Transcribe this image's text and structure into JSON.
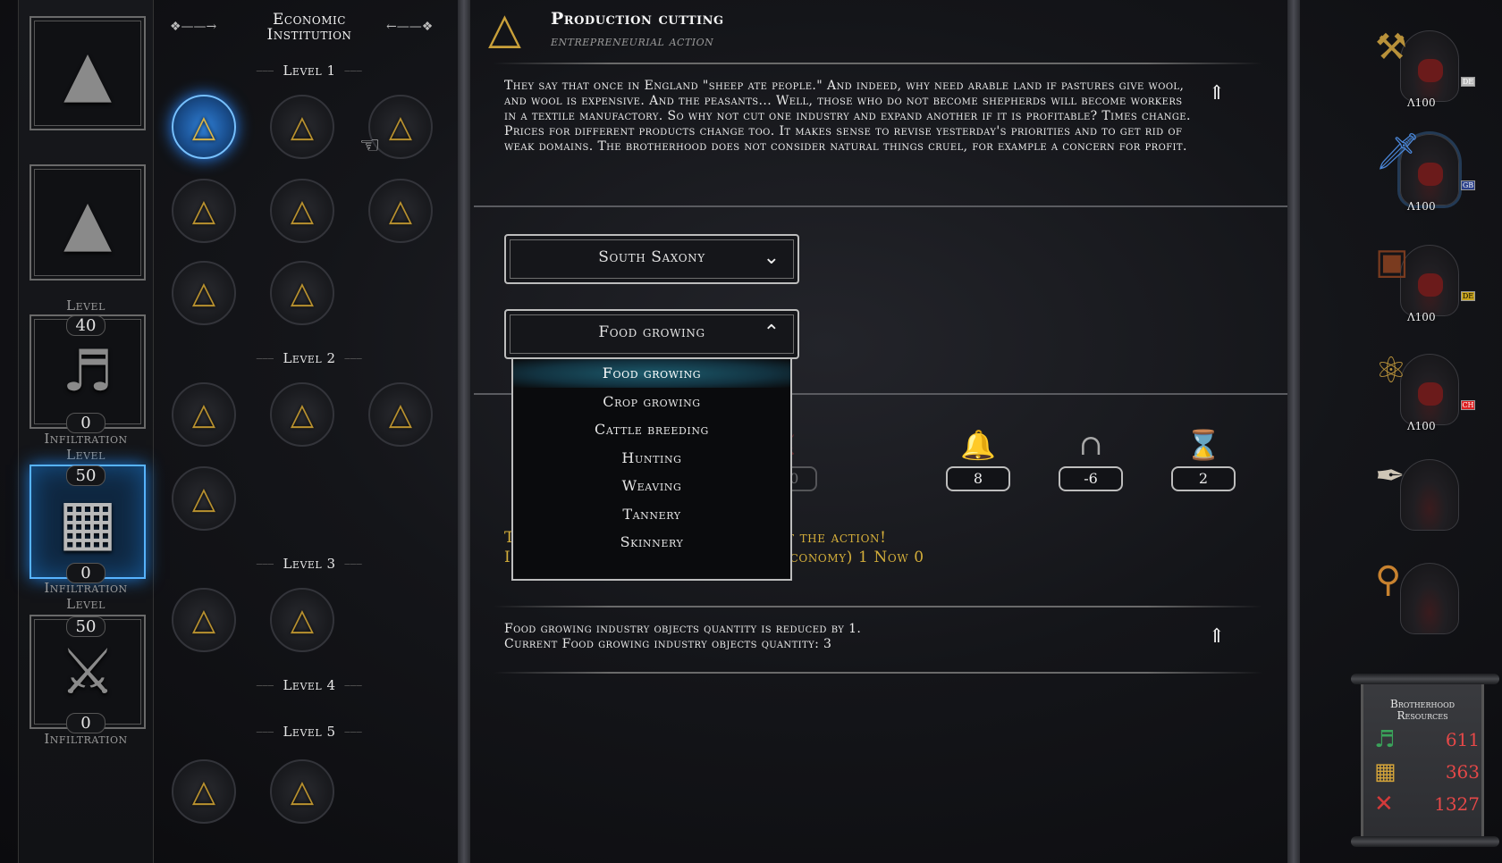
{
  "institutions": [
    {
      "name": "hooded-figure",
      "level_label": "",
      "level": "",
      "value": "",
      "infiltration_label": ""
    },
    {
      "name": "pyramid-eye",
      "level_label": "Level",
      "level": "40",
      "value": "",
      "infiltration_label": ""
    },
    {
      "name": "lyre",
      "level_label": "Level",
      "level": "50",
      "value": "0",
      "infiltration_label": "Infiltration"
    },
    {
      "name": "gold-bars",
      "level_label": "Level",
      "level": "50",
      "value": "0",
      "infiltration_label": "Infiltration"
    },
    {
      "name": "crossed-swords",
      "level_label": "",
      "level": "",
      "value": "0",
      "infiltration_label": "Infiltration"
    }
  ],
  "tree": {
    "title_line1": "Economic",
    "title_line2": "Institution",
    "levels": [
      "Level 1",
      "Level 2",
      "Level 3",
      "Level 4",
      "Level 5"
    ]
  },
  "action": {
    "title": "Production cutting",
    "subtitle": "entrepreneurial action",
    "description": "They say that once in England \"sheep ate people.\" And indeed, why need arable land if pastures give wool, and wool is expensive. And the peasants... Well, those who do not become shepherds will become workers in a textile manufactory. So why not cut one industry and expand another if it is profitable? Times change. Prices for different products change too. It makes sense to revise yesterday's priorities and to get rid of weak domains. The brotherhood does not consider natural things cruel, for example a concern for profit."
  },
  "region_dropdown": {
    "value": "South Saxony"
  },
  "industry_dropdown": {
    "value": "Food growing",
    "options": [
      "Food growing",
      "Crop growing",
      "Cattle breeding",
      "Hunting",
      "Weaving",
      "Tannery",
      "Skinnery"
    ],
    "highlighted": "Food growing"
  },
  "stats": {
    "hidden_1": "100",
    "hidden_2": "100",
    "bell": "8",
    "influence": "-6",
    "time": "2"
  },
  "warning": {
    "line1": "The lodge needs to be active to start the action!",
    "line2": "Infiltration Economic Institution (Economy) 1 Now 0"
  },
  "result": {
    "line1": "Food growing industry objects quantity is reduced by 1.",
    "line2": "Current Food growing industry objects quantity: 3"
  },
  "agents": [
    {
      "tool": "hammer",
      "level": "100",
      "flag": "DE"
    },
    {
      "tool": "sword",
      "level": "100",
      "flag": "GB"
    },
    {
      "tool": "book",
      "level": "100",
      "flag": "DE"
    },
    {
      "tool": "key",
      "level": "100",
      "flag": "CH"
    },
    {
      "tool": "quill",
      "level": "",
      "flag": ""
    },
    {
      "tool": "horn",
      "level": "",
      "flag": ""
    }
  ],
  "resources": {
    "title_line1": "Brotherhood",
    "title_line2": "Resources",
    "items": [
      {
        "icon": "lyre-icon",
        "value": "611",
        "color": "#3aa35a"
      },
      {
        "icon": "gold-icon",
        "value": "363",
        "color": "#d4a43a"
      },
      {
        "icon": "swords-icon",
        "value": "1327",
        "color": "#d33a3a"
      }
    ]
  },
  "colors": {
    "accent_blue": "#2a88ff",
    "gold": "#c9a03a",
    "warning": "#d4ae3a",
    "resource_value": "#e54848"
  }
}
